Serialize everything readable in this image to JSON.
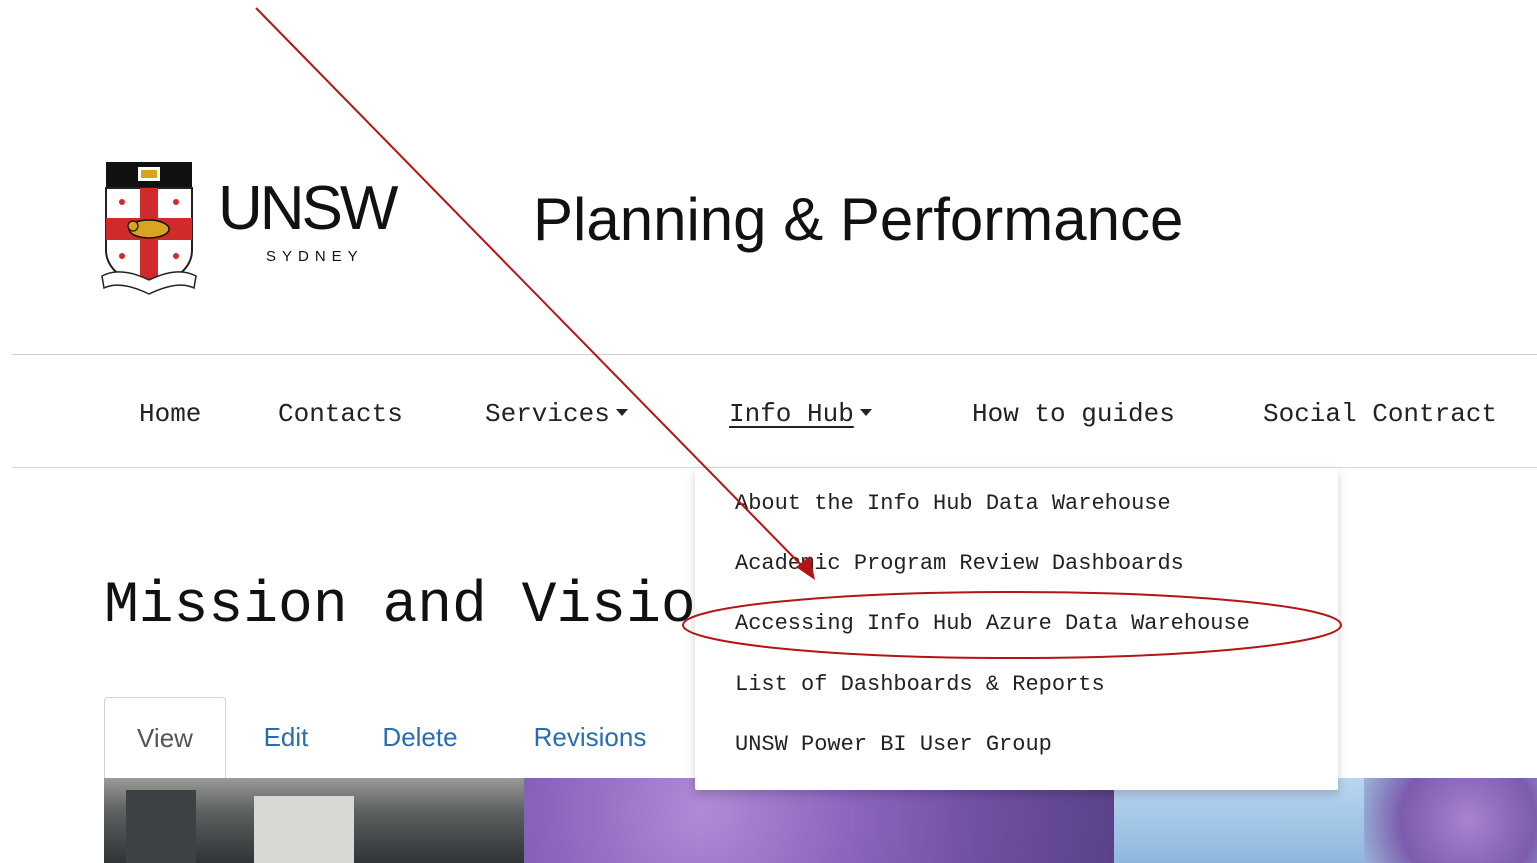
{
  "header": {
    "logo": {
      "wordmark": "UNSW",
      "sub": "SYDNEY",
      "motto": "MANU ET MENTE"
    },
    "site_title": "Planning & Performance"
  },
  "nav": {
    "items": [
      {
        "label": "Home"
      },
      {
        "label": "Contacts"
      },
      {
        "label": "Services"
      },
      {
        "label": "Info Hub"
      },
      {
        "label": "How to guides"
      },
      {
        "label": "Social Contract"
      }
    ]
  },
  "dropdown": {
    "items": [
      {
        "label": "About the Info Hub Data Warehouse"
      },
      {
        "label": "Academic Program Review Dashboards"
      },
      {
        "label": "Accessing Info Hub Azure Data Warehouse"
      },
      {
        "label": "List of Dashboards & Reports"
      },
      {
        "label": "UNSW Power BI User Group"
      }
    ]
  },
  "page": {
    "title": "Mission and Visio"
  },
  "tabs": {
    "items": [
      {
        "label": "View"
      },
      {
        "label": "Edit"
      },
      {
        "label": "Delete"
      },
      {
        "label": "Revisions"
      }
    ]
  },
  "colors": {
    "link_blue": "#2a6cb4",
    "annotation_red": "#b41414",
    "crest_red": "#d02a2a",
    "crest_gold": "#d9a520"
  },
  "icons": {
    "services_caret": "caret-down-icon",
    "infohub_caret": "caret-down-icon",
    "crest": "unsw-crest-icon"
  }
}
